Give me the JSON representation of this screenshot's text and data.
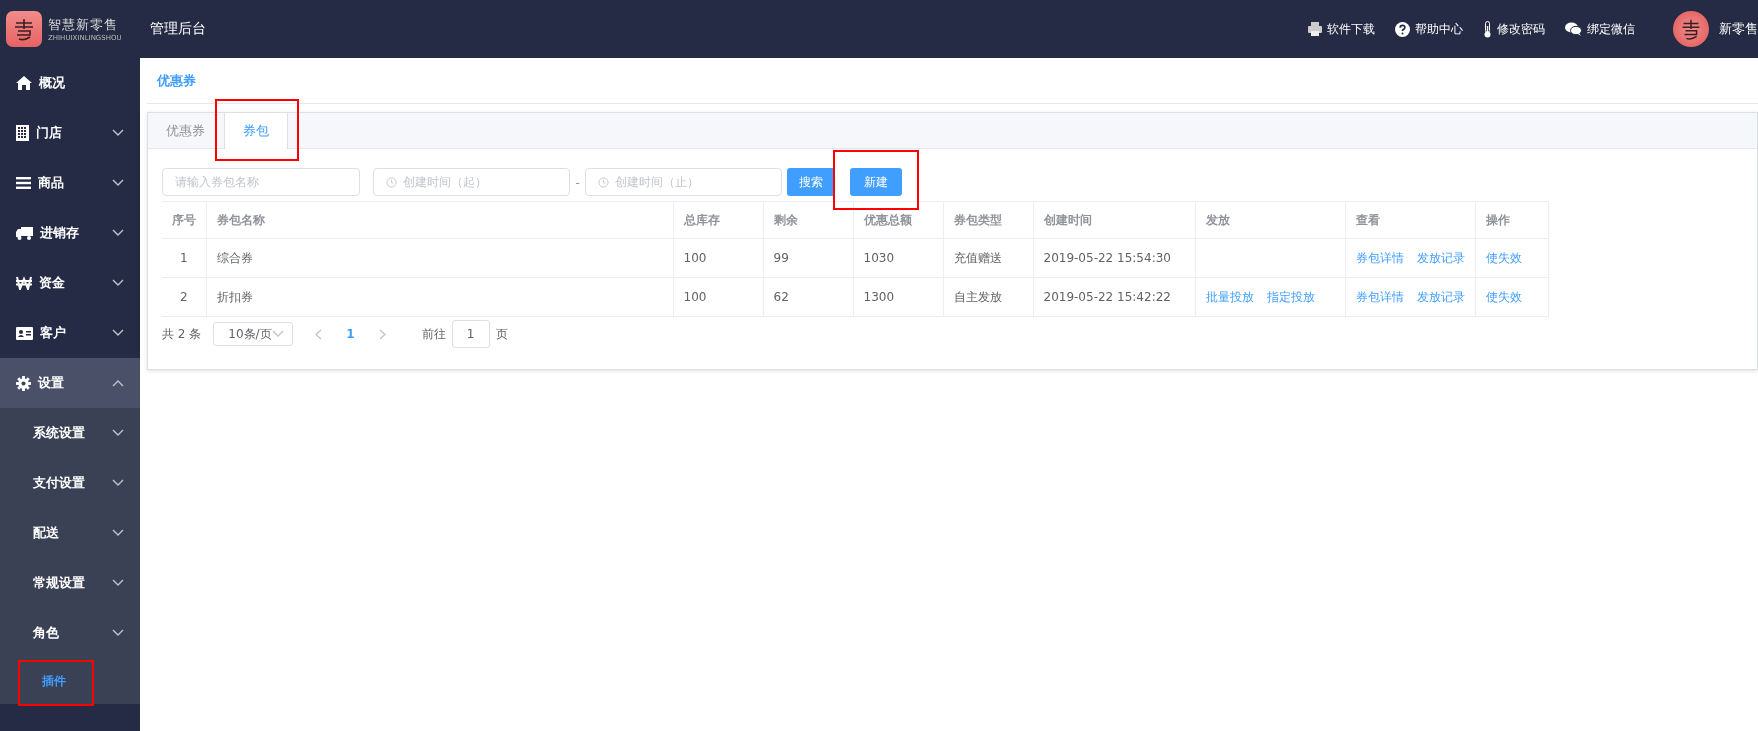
{
  "header": {
    "logo_title": "智慧新零售",
    "logo_subtitle": "ZHIHUIXINLINGSHOU",
    "app_title": "管理后台",
    "actions": [
      {
        "label": "软件下载"
      },
      {
        "label": "帮助中心"
      },
      {
        "label": "修改密码"
      },
      {
        "label": "绑定微信"
      }
    ],
    "user_name": "新零售"
  },
  "sidebar": {
    "items": [
      {
        "label": "概况",
        "expanded": false,
        "has_children": false
      },
      {
        "label": "门店",
        "expanded": false,
        "has_children": true
      },
      {
        "label": "商品",
        "expanded": false,
        "has_children": true
      },
      {
        "label": "进销存",
        "expanded": false,
        "has_children": true
      },
      {
        "label": "资金",
        "expanded": false,
        "has_children": true
      },
      {
        "label": "客户",
        "expanded": false,
        "has_children": true
      },
      {
        "label": "设置",
        "expanded": true,
        "has_children": true,
        "children": [
          {
            "label": "系统设置",
            "has_children": true,
            "selected": false
          },
          {
            "label": "支付设置",
            "has_children": true,
            "selected": false
          },
          {
            "label": "配送",
            "has_children": true,
            "selected": false
          },
          {
            "label": "常规设置",
            "has_children": true,
            "selected": false
          },
          {
            "label": "角色",
            "has_children": true,
            "selected": false
          },
          {
            "label": "插件",
            "has_children": false,
            "selected": true
          }
        ]
      }
    ]
  },
  "breadcrumb": "优惠券",
  "tabs": [
    {
      "label": "优惠券",
      "selected": false
    },
    {
      "label": "券包",
      "selected": true
    }
  ],
  "filters": {
    "name_placeholder": "请输入券包名称",
    "start_placeholder": "创建时间（起）",
    "separator": "-",
    "end_placeholder": "创建时间（止）",
    "search_button": "搜索",
    "new_button": "新建"
  },
  "table": {
    "columns": [
      "序号",
      "券包名称",
      "总库存",
      "剩余",
      "优惠总额",
      "券包类型",
      "创建时间",
      "发放",
      "查看",
      "操作"
    ],
    "rows": [
      {
        "no": "1",
        "name": "综合券",
        "stock": "100",
        "remaining": "99",
        "total": "1030",
        "type": "充值赠送",
        "created": "2019-05-22 15:54:30",
        "issue": [],
        "view": [
          "券包详情",
          "发放记录"
        ],
        "ops": [
          "使失效"
        ]
      },
      {
        "no": "2",
        "name": "折扣券",
        "stock": "100",
        "remaining": "62",
        "total": "1300",
        "type": "自主发放",
        "created": "2019-05-22 15:42:22",
        "issue": [
          "批量投放",
          "指定投放"
        ],
        "view": [
          "券包详情",
          "发放记录"
        ],
        "ops": [
          "使失效"
        ]
      }
    ]
  },
  "pagination": {
    "total": "共 2 条",
    "page_size": "10条/页",
    "pages": [
      {
        "label": "1",
        "selected": true
      }
    ],
    "goto_label": "前往",
    "goto_value": "1",
    "goto_suffix": "页"
  }
}
